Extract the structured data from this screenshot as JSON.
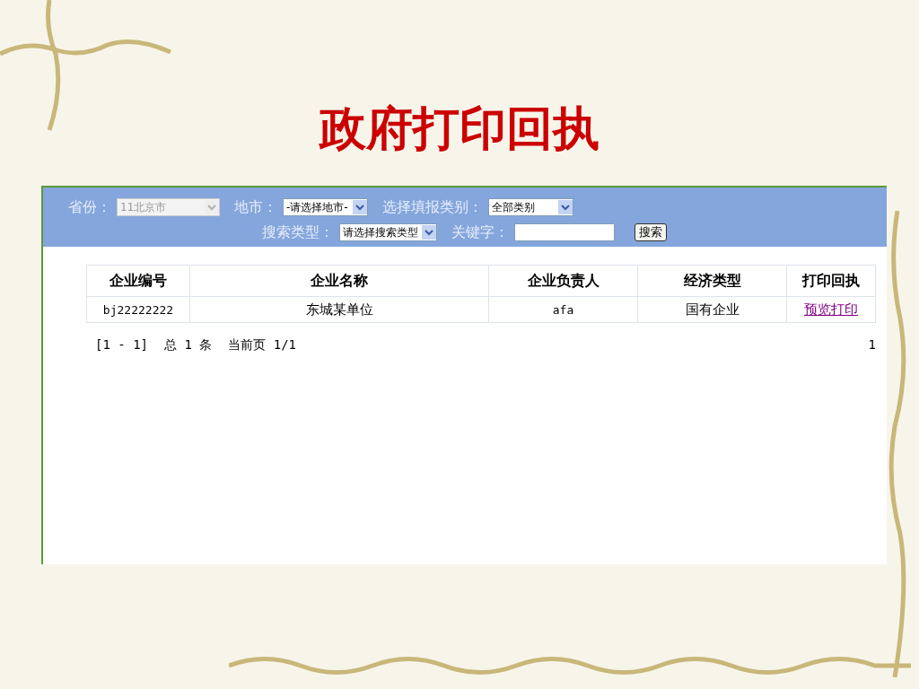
{
  "title": "政府打印回执",
  "filters": {
    "region_filters": [
      {
        "kind": "select",
        "label": "省份：",
        "value": "11北京市",
        "disabled": true
      },
      {
        "kind": "select",
        "label": "地市：",
        "value": "-请选择地市-",
        "disabled": false
      },
      {
        "kind": "select",
        "label": "选择填报类别：",
        "value": "全部类别",
        "disabled": false
      }
    ],
    "search_filters": [
      {
        "kind": "select",
        "label": "搜索类型：",
        "value": "请选择搜索类型",
        "disabled": false
      },
      {
        "kind": "input",
        "label": "关键字："
      },
      {
        "kind": "button",
        "value": "搜索"
      }
    ]
  },
  "table": {
    "columns": [
      "企业编号",
      "企业名称",
      "企业负责人",
      "经济类型",
      "打印回执"
    ],
    "rows": [
      {
        "cells": [
          "bj22222222",
          "东城某单位",
          "afa",
          "国有企业"
        ],
        "action": "预览打印"
      }
    ]
  },
  "pager": {
    "range": "[1 - 1]",
    "total": "总 1 条",
    "current": "当前页 1/1",
    "page": "1"
  }
}
